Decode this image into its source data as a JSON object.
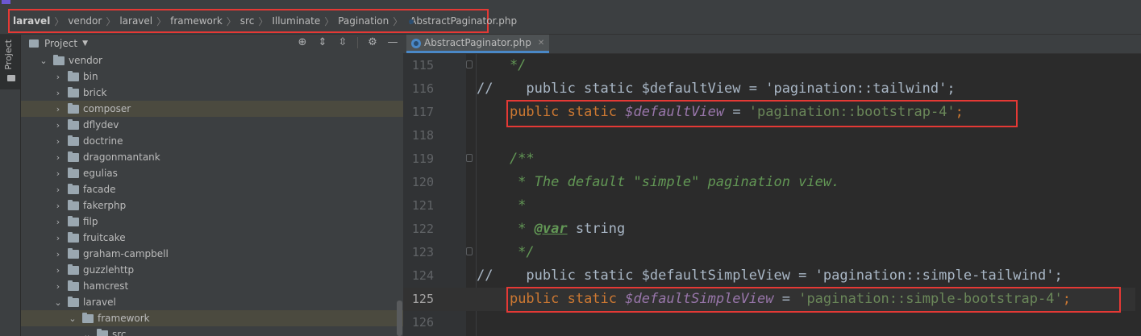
{
  "breadcrumb": [
    "laravel",
    "vendor",
    "laravel",
    "framework",
    "src",
    "Illuminate",
    "Pagination",
    "AbstractPaginator.php"
  ],
  "sidebar_tab": "Project",
  "project_panel": {
    "title": "Project",
    "tree": [
      {
        "label": "vendor",
        "expanded": true,
        "depth": 1
      },
      {
        "label": "bin",
        "expanded": false,
        "depth": 2
      },
      {
        "label": "brick",
        "expanded": false,
        "depth": 2
      },
      {
        "label": "composer",
        "expanded": false,
        "depth": 2,
        "highlighted": true
      },
      {
        "label": "dflydev",
        "expanded": false,
        "depth": 2
      },
      {
        "label": "doctrine",
        "expanded": false,
        "depth": 2
      },
      {
        "label": "dragonmantank",
        "expanded": false,
        "depth": 2
      },
      {
        "label": "egulias",
        "expanded": false,
        "depth": 2
      },
      {
        "label": "facade",
        "expanded": false,
        "depth": 2
      },
      {
        "label": "fakerphp",
        "expanded": false,
        "depth": 2
      },
      {
        "label": "filp",
        "expanded": false,
        "depth": 2
      },
      {
        "label": "fruitcake",
        "expanded": false,
        "depth": 2
      },
      {
        "label": "graham-campbell",
        "expanded": false,
        "depth": 2
      },
      {
        "label": "guzzlehttp",
        "expanded": false,
        "depth": 2
      },
      {
        "label": "hamcrest",
        "expanded": false,
        "depth": 2
      },
      {
        "label": "laravel",
        "expanded": true,
        "depth": 2
      },
      {
        "label": "framework",
        "expanded": true,
        "depth": 3,
        "highlighted": true
      },
      {
        "label": "src",
        "expanded": true,
        "depth": 4
      }
    ]
  },
  "editor": {
    "tab_label": "AbstractPaginator.php",
    "current_line": 125,
    "lines": [
      {
        "num": "115",
        "tokens": [
          {
            "t": "    */",
            "c": "doc"
          }
        ]
      },
      {
        "num": "116",
        "tokens": [
          {
            "t": "//    public static $defaultView = 'pagination::tailwind';",
            "c": "plain"
          }
        ]
      },
      {
        "num": "117",
        "tokens": [
          {
            "t": "    ",
            "c": "plain"
          },
          {
            "t": "public static ",
            "c": "kw"
          },
          {
            "t": "$defaultView",
            "c": "var"
          },
          {
            "t": " = ",
            "c": "plain"
          },
          {
            "t": "'pagination::bootstrap-4'",
            "c": "str"
          },
          {
            "t": ";",
            "c": "kw"
          }
        ]
      },
      {
        "num": "118",
        "tokens": []
      },
      {
        "num": "119",
        "tokens": [
          {
            "t": "    /**",
            "c": "doc"
          }
        ]
      },
      {
        "num": "120",
        "tokens": [
          {
            "t": "     * The default \"simple\" pagination view.",
            "c": "doc"
          }
        ]
      },
      {
        "num": "121",
        "tokens": [
          {
            "t": "     *",
            "c": "doc"
          }
        ]
      },
      {
        "num": "122",
        "tokens": [
          {
            "t": "     * ",
            "c": "doc"
          },
          {
            "t": "@var",
            "c": "tag"
          },
          {
            "t": " string",
            "c": "plain"
          }
        ]
      },
      {
        "num": "123",
        "tokens": [
          {
            "t": "     */",
            "c": "doc"
          }
        ]
      },
      {
        "num": "124",
        "tokens": [
          {
            "t": "//    public static $defaultSimpleView = 'pagination::simple-tailwind';",
            "c": "plain"
          }
        ]
      },
      {
        "num": "125",
        "tokens": [
          {
            "t": "    ",
            "c": "plain"
          },
          {
            "t": "public static ",
            "c": "kw"
          },
          {
            "t": "$defaultSimpleView",
            "c": "var"
          },
          {
            "t": " = ",
            "c": "plain"
          },
          {
            "t": "'pagination::simple-bootstrap-4'",
            "c": "str"
          },
          {
            "t": ";",
            "c": "kw"
          }
        ]
      },
      {
        "num": "126",
        "tokens": []
      }
    ]
  },
  "icons": {
    "locate": "crosshair-icon",
    "expand": "expand-all-icon",
    "collapse": "collapse-all-icon",
    "settings": "gear-icon",
    "hide": "minimize-icon"
  },
  "colors": {
    "highlight_box": "#e53935",
    "keyword": "#cc7832",
    "variable": "#9876aa",
    "string": "#6a8759",
    "doc_comment": "#629755"
  }
}
